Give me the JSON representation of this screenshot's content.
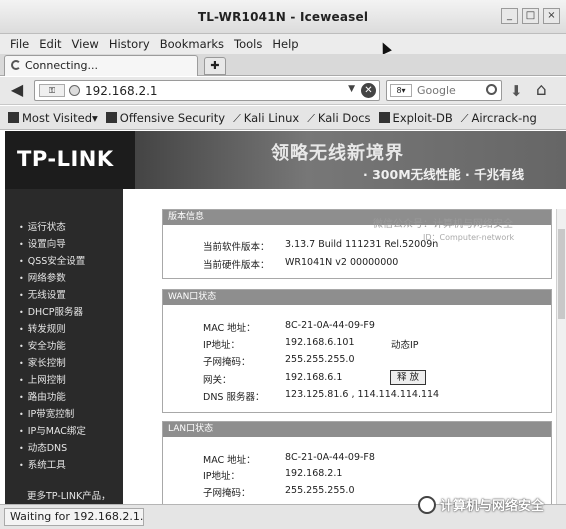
{
  "window": {
    "title": "TL-WR1041N - Iceweasel",
    "buttons": [
      "_",
      "□",
      "×"
    ]
  },
  "menubar": [
    "File",
    "Edit",
    "View",
    "History",
    "Bookmarks",
    "Tools",
    "Help"
  ],
  "tab": {
    "label": "Connecting..."
  },
  "navbar": {
    "url": "192.168.2.1",
    "search_placeholder": "Google"
  },
  "bookmarks": [
    "Most Visited",
    "Offensive Security",
    "Kali Linux",
    "Kali Docs",
    "Exploit-DB",
    "Aircrack-ng"
  ],
  "banner": {
    "logo": "TP-LINK",
    "slogan": "领略无线新境界",
    "subline": "· 300M无线性能  · 千兆有线"
  },
  "sidebar": {
    "items": [
      "运行状态",
      "设置向导",
      "QSS安全设置",
      "网络参数",
      "无线设置",
      "DHCP服务器",
      "转发规则",
      "安全功能",
      "家长控制",
      "上网控制",
      "路由功能",
      "IP带宽控制",
      "IP与MAC绑定",
      "动态DNS",
      "系统工具"
    ],
    "more": "更多TP-LINK产品，"
  },
  "watermark": {
    "top": "微信公众号：计算机与网络安全",
    "top_sub": "ID：Computer-network",
    "bottom": "计算机与网络安全"
  },
  "version_panel": {
    "heading": "版本信息",
    "rows": [
      {
        "label": "当前软件版本：",
        "value": "3.13.7 Build 111231 Rel.52009n"
      },
      {
        "label": "当前硬件版本：",
        "value": "WR1041N v2 00000000"
      }
    ]
  },
  "wan_panel": {
    "heading": "WAN口状态",
    "mac_label": "MAC 地址：",
    "mac": "8C-21-0A-44-09-F9",
    "ip_label": "IP地址：",
    "ip": "192.168.6.101",
    "ip_type": "动态IP",
    "mask_label": "子网掩码：",
    "mask": "255.255.255.0",
    "gateway_label": "网关：",
    "gateway": "192.168.6.1",
    "renew_button": "释 放",
    "dns_label": "DNS 服务器：",
    "dns": "123.125.81.6 , 114.114.114.114"
  },
  "lan_panel": {
    "heading": "LAN口状态",
    "mac_label": "MAC 地址：",
    "mac": "8C-21-0A-44-09-F8",
    "ip_label": "IP地址：",
    "ip": "192.168.2.1",
    "mask_label": "子网掩码：",
    "mask": "255.255.255.0"
  },
  "status": {
    "text": "Waiting for 192.168.2.1..."
  }
}
